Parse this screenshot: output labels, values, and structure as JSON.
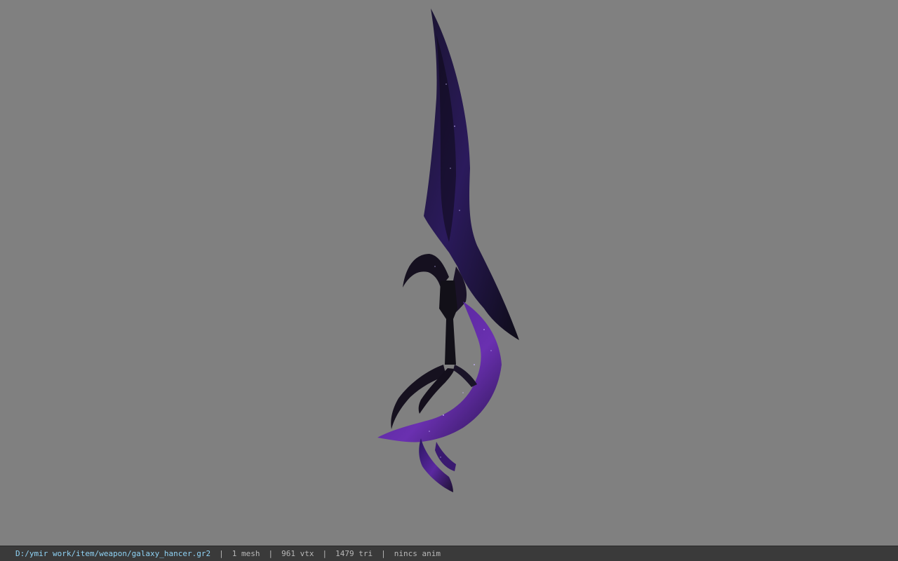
{
  "statusbar": {
    "file_path": "D:/ymir work/item/weapon/galaxy_hancer.gr2",
    "separator": "|",
    "mesh_count": "1 mesh",
    "vertex_count": "961 vtx",
    "triangle_count": "1479 tri",
    "animation": "nincs anim"
  },
  "colors": {
    "viewport_background": "#808080",
    "statusbar_background": "#3a3a3a",
    "path_text": "#8fd3f5",
    "info_text": "#b8b8b8",
    "model_dark": "#12101e",
    "model_purple": "#3d1a7a",
    "model_violet": "#6a2eb0"
  },
  "viewport": {
    "model": "sword-model"
  }
}
